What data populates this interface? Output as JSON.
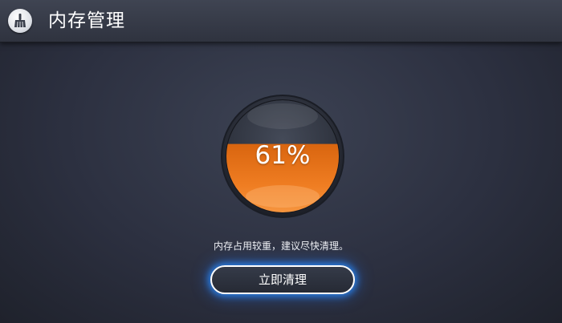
{
  "header": {
    "icon": "broom-icon",
    "title": "内存管理"
  },
  "memory": {
    "usage_percent": 61,
    "usage_label": "61%",
    "hint": "内存占用较重，建议尽快清理。"
  },
  "actions": {
    "clean_label": "立即清理"
  },
  "colors": {
    "accent_fill": "#e8741c",
    "button_glow": "#2a8cff",
    "background": "#2c3040"
  }
}
